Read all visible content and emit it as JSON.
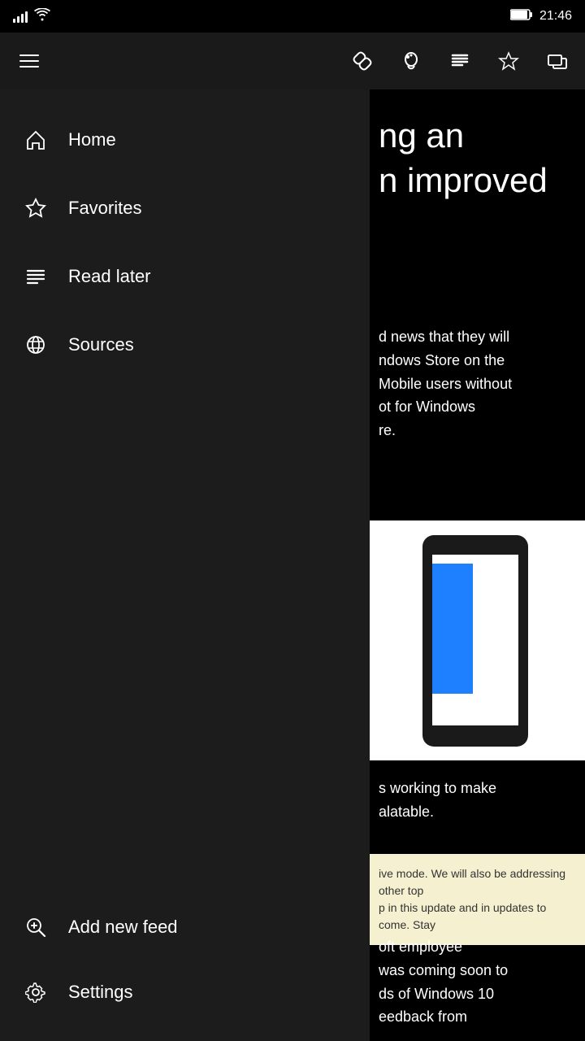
{
  "statusBar": {
    "time": "21:46",
    "batteryIcon": "🔋",
    "signalBars": 4,
    "wifiIcon": "wifi"
  },
  "toolbar": {
    "hamburgerLabel": "menu",
    "icons": [
      {
        "name": "link-icon",
        "symbol": "link",
        "label": "Link"
      },
      {
        "name": "notifications-icon",
        "symbol": "bell",
        "label": "Notifications"
      },
      {
        "name": "reading-list-icon",
        "symbol": "list",
        "label": "Reading list"
      },
      {
        "name": "favorites-icon",
        "symbol": "star",
        "label": "Favorites"
      },
      {
        "name": "share-icon",
        "symbol": "share",
        "label": "Share"
      }
    ]
  },
  "sidebar": {
    "items": [
      {
        "id": "home",
        "label": "Home",
        "icon": "home"
      },
      {
        "id": "favorites",
        "label": "Favorites",
        "icon": "star"
      },
      {
        "id": "read-later",
        "label": "Read later",
        "icon": "lines"
      },
      {
        "id": "sources",
        "label": "Sources",
        "icon": "globe"
      }
    ],
    "bottomItems": [
      {
        "id": "add-feed",
        "label": "Add new feed",
        "icon": "search-plus"
      },
      {
        "id": "settings",
        "label": "Settings",
        "icon": "gear"
      }
    ]
  },
  "article": {
    "headingPartial": "ng an\nn improved",
    "bodyText1": "d news that they will\nndows Store on the\nMobile users without\not for Windows\nre.",
    "bodyText2": "s working to make\nalatable.",
    "quoteText": "ive mode. We will also be addressing other top\np in this update and in updates to come. Stay",
    "bodyText3": "oft employee\nwas coming soon to\nds of Windows 10\needback from\n"
  }
}
